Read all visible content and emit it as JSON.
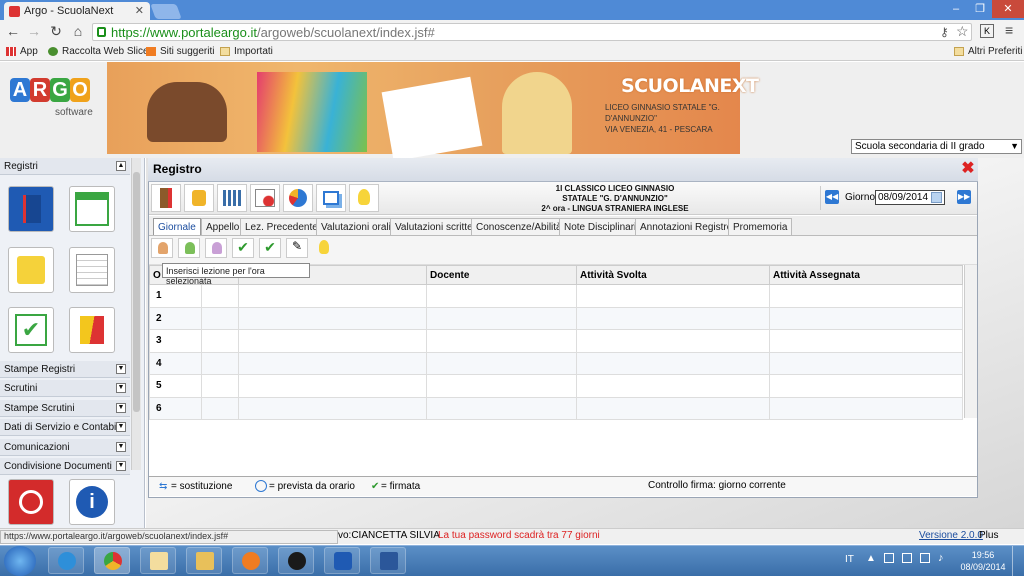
{
  "browser": {
    "tab_title": "Argo - ScuolaNext",
    "url_host": "https://www.portaleargo.it",
    "url_path": "/argoweb/scuolanext/index.jsf#",
    "bookmarks": [
      "App",
      "Raccolta Web Slice",
      "Siti suggeriti",
      "Importati"
    ],
    "other_bookmarks": "Altri Preferiti",
    "status_url": "https://www.portaleargo.it/argoweb/scuolanext/index.jsf#"
  },
  "header": {
    "logo_letters": [
      "A",
      "R",
      "G",
      "O"
    ],
    "logo_sub": "software",
    "brand": "SCUOLANEXT",
    "school_line1": "LICEO GINNASIO STATALE \"G.",
    "school_line2": "D'ANNUNZIO\"",
    "school_line3": "VIA VENEZIA, 41 - PESCARA",
    "school_select": "Scuola secondaria di II grado"
  },
  "sidebar": {
    "registri_label": "Registri",
    "sections": [
      "Stampe Registri",
      "Scrutini",
      "Stampe Scrutini",
      "Dati di Servizio e Contabili",
      "Comunicazioni",
      "Condivisione Documenti"
    ]
  },
  "registro": {
    "title": "Registro",
    "class_line1": "1I CLASSICO LICEO GINNASIO",
    "class_line2": "STATALE \"G. D'ANNUNZIO\"",
    "class_line3": "2^ ora - LINGUA STRANIERA INGLESE",
    "giorno_label": "Giorno:",
    "giorno_value": "08/09/2014",
    "tabs": [
      "Giornale",
      "Appello",
      "Lez. Precedente",
      "Valutazioni orali",
      "Valutazioni scritte",
      "Conoscenze/Abilità",
      "Note Disciplinari",
      "Annotazioni Registro",
      "Promemoria"
    ],
    "tooltip": "Inserisci lezione per l'ora selezionata",
    "columns": [
      "O",
      "",
      "",
      "Docente",
      "Attività Svolta",
      "Attività Assegnata"
    ],
    "rows": [
      "1",
      "2",
      "3",
      "4",
      "5",
      "6"
    ],
    "legend_sostituzione": "= sostituzione",
    "legend_prevista": "= prevista da orario",
    "legend_firmata": "= firmata",
    "controllo_firma": "Controllo firma: giorno corrente"
  },
  "status": {
    "user": "vo:CIANCETTA SILVIA",
    "password_warning": "La tua password scadrà tra 77 giorni",
    "version": "Versione 2.0.0",
    "plus": "Plus"
  },
  "taskbar": {
    "lang": "IT",
    "time": "19:56",
    "date": "08/09/2014"
  },
  "colors": {
    "accent": "#2e78d3",
    "warning": "#dd2222",
    "taskbar": "#3a6ea8"
  }
}
